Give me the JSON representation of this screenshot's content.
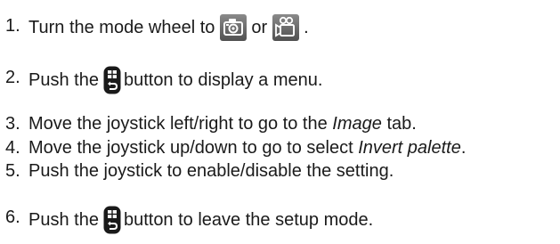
{
  "steps": [
    {
      "number": "1.",
      "before": "Turn the mode wheel to",
      "icon1": "camera-mode-icon",
      "middle": "or",
      "icon2": "video-mode-icon",
      "after": "."
    },
    {
      "number": "2.",
      "before": "Push the",
      "icon": "menu-back-button-icon",
      "after": "button to display a menu."
    },
    {
      "number": "3.",
      "before": "Move the joystick left/right to go to the",
      "emph": "Image",
      "after": "tab."
    },
    {
      "number": "4.",
      "before": "Move the joystick up/down to go to select",
      "emph": "Invert palette",
      "after": "."
    },
    {
      "number": "5.",
      "text": "Push the joystick to enable/disable the setting."
    },
    {
      "number": "6.",
      "before": "Push the",
      "icon": "menu-back-button-icon",
      "after": "button to leave the setup mode."
    }
  ],
  "colors": {
    "text": "#1a1a1a",
    "icon_background": "#6a6a6a",
    "icon_foreground": "#ffffff",
    "button_fill": "#1a1a1a"
  }
}
